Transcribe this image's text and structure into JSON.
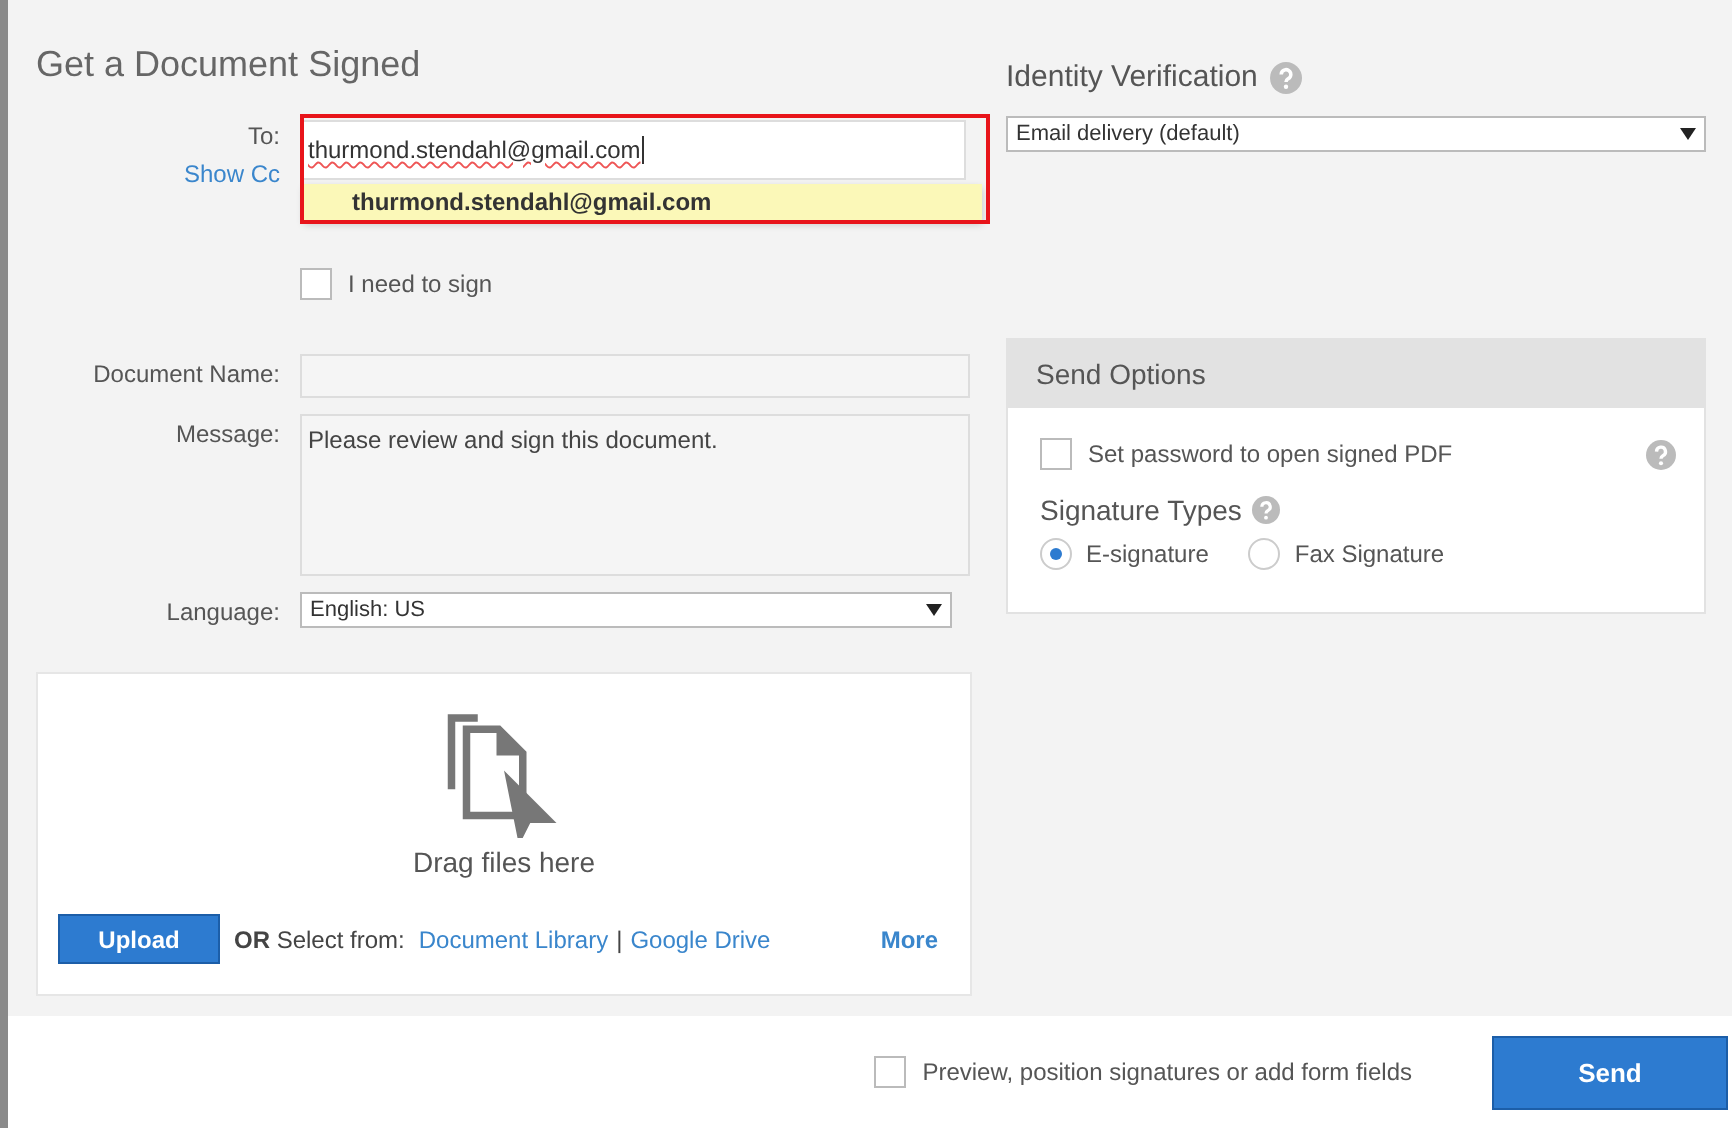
{
  "title": "Get a Document Signed",
  "recipients": {
    "label": "To:",
    "show_cc": "Show Cc",
    "value": "thurmond.stendahl@gmail.com",
    "suggestion": "thurmond.stendahl@gmail.com"
  },
  "i_need_to_sign": {
    "label": "I need to sign",
    "checked": false
  },
  "document_name": {
    "label": "Document Name:"
  },
  "message": {
    "label": "Message:",
    "value": "Please review and sign this document."
  },
  "language": {
    "label": "Language:",
    "value": "English: US"
  },
  "upload": {
    "drop_text": "Drag files here",
    "upload_button": "Upload",
    "select_from": "**OR** Select from:",
    "sources": [
      "Document Library",
      "Google Drive"
    ],
    "separator": "|",
    "more": "More"
  },
  "identity_verification": {
    "title": "Identity Verification",
    "value": "Email delivery (default)"
  },
  "send_options": {
    "title": "Send Options",
    "password": {
      "label": "Set password to open signed PDF",
      "checked": false
    },
    "signature_types_title": "Signature Types",
    "signature_types": [
      {
        "label": "E-signature",
        "selected": true
      },
      {
        "label": "Fax Signature",
        "selected": false
      }
    ]
  },
  "footer": {
    "preview": {
      "label": "Preview, position signatures or add form fields",
      "checked": false
    },
    "send": "Send"
  }
}
